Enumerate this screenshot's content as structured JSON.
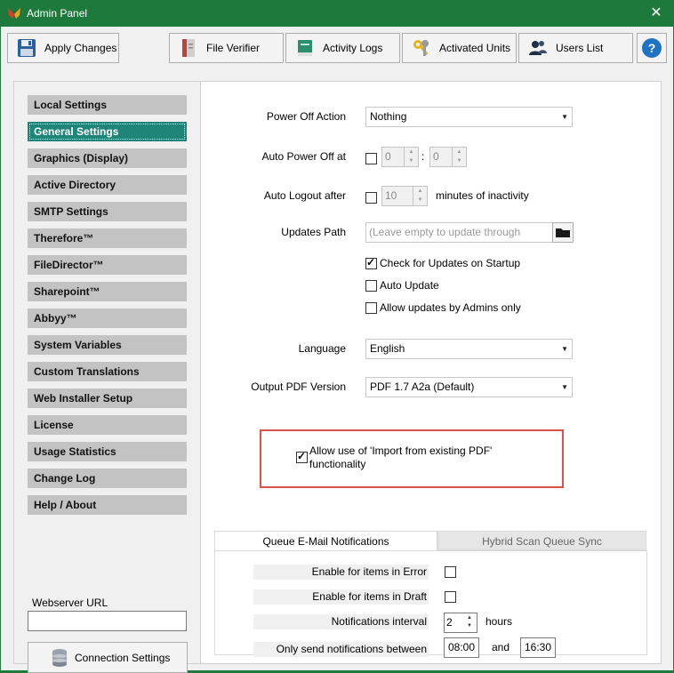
{
  "window": {
    "title": "Admin Panel",
    "close_glyph": "✕"
  },
  "toolbar": {
    "apply": "Apply Changes",
    "file_verifier": "File Verifier",
    "activity_logs": "Activity Logs",
    "activated_units": "Activated Units",
    "users_list": "Users List",
    "help": "?"
  },
  "nav": {
    "items": [
      "Local Settings",
      "General Settings",
      "Graphics (Display)",
      "Active Directory",
      "SMTP Settings",
      "Therefore™",
      "FileDirector™",
      "Sharepoint™",
      "Abbyy™",
      "System Variables",
      "Custom Translations",
      "Web Installer Setup",
      "License",
      "Usage Statistics",
      "Change Log",
      "Help / About"
    ],
    "active": "General Settings",
    "webserver_label": "Webserver URL",
    "webserver_value": "",
    "connection_settings": "Connection Settings"
  },
  "general": {
    "power_off_label": "Power Off Action",
    "power_off_value": "Nothing",
    "auto_power_label": "Auto Power Off at",
    "auto_power_hour": "0",
    "auto_power_sep": ":",
    "auto_power_min": "0",
    "auto_logout_label": "Auto Logout after",
    "auto_logout_value": "10",
    "auto_logout_suffix": "minutes of inactivity",
    "updates_path_label": "Updates Path",
    "updates_path_placeholder": "(Leave empty to update through",
    "check_updates_label": "Check for Updates on Startup",
    "auto_update_label": "Auto Update",
    "admins_only_label": "Allow updates by Admins only",
    "language_label": "Language",
    "language_value": "English",
    "pdf_version_label": "Output PDF Version",
    "pdf_version_value": "PDF 1.7 A2a (Default)",
    "import_pdf_line1": "Allow use of 'Import from existing PDF'",
    "import_pdf_line2": "functionality"
  },
  "tabs": {
    "active": "Queue E-Mail Notifications",
    "inactive": "Hybrid Scan Queue Sync"
  },
  "notifications": {
    "errors_label": "Enable for items in Error",
    "draft_label": "Enable for items in Draft",
    "interval_label": "Notifications interval",
    "interval_value": "2",
    "interval_unit": "hours",
    "between_label": "Only send notifications between",
    "from_time": "08:00",
    "and_label": "and",
    "to_time": "16:30"
  },
  "colors": {
    "title_bar": "#1e7a3c",
    "active_nav": "#1e8578",
    "highlight": "#d9534f"
  },
  "icons": {
    "app": "app-logo-icon",
    "apply": "floppy-disk-icon",
    "file_verifier": "document-icon",
    "activity_logs": "book-icon",
    "activated_units": "keys-icon",
    "users_list": "users-icon",
    "help": "question-icon",
    "connection": "database-icon",
    "folder": "folder-icon"
  }
}
